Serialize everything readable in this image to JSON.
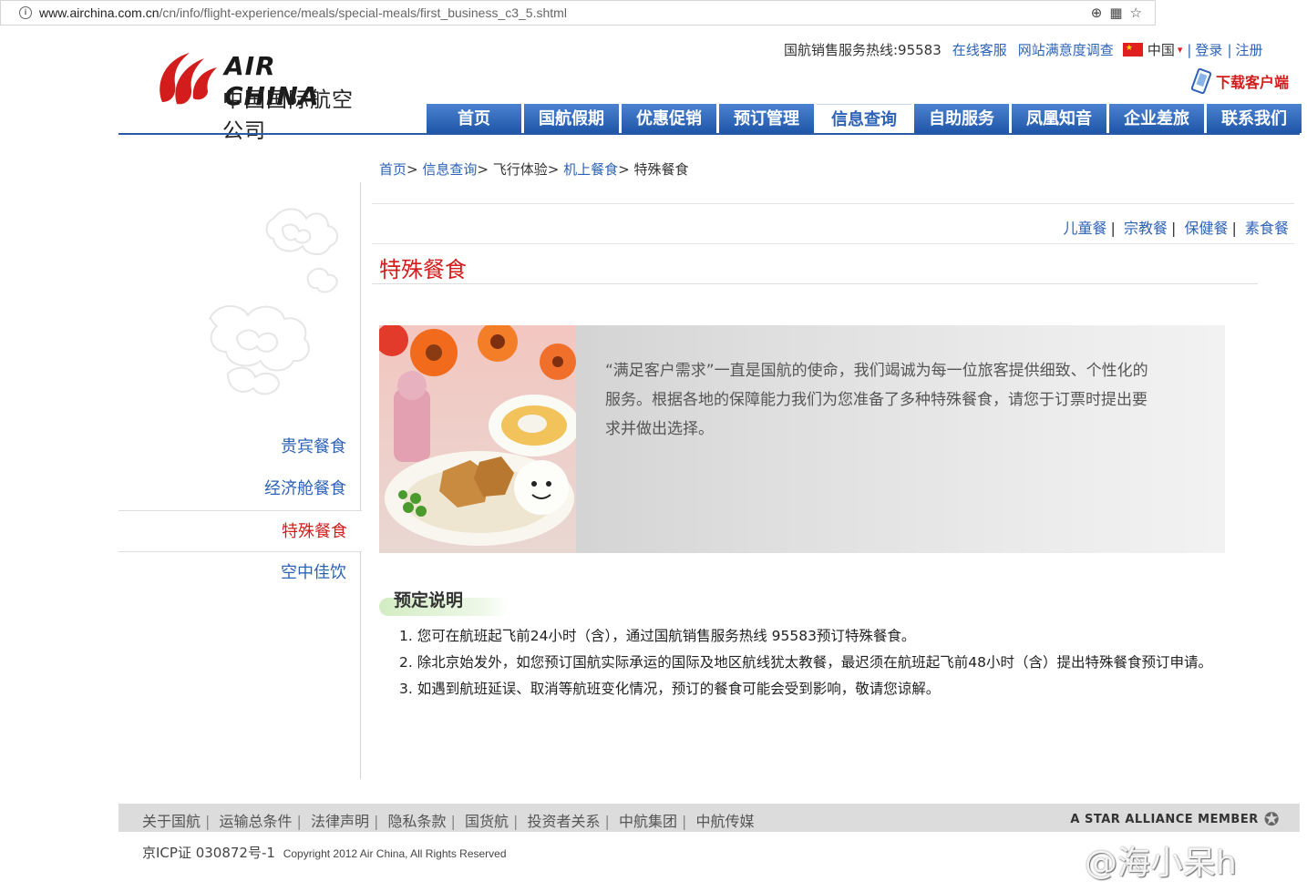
{
  "browser": {
    "url_host": "www.airchina.com.cn",
    "url_path": "/cn/info/flight-experience/meals/special-meals/first_business_c3_5.shtml",
    "tool_icons": [
      "zoom-icon",
      "qr-icon",
      "star-icon"
    ]
  },
  "header": {
    "logo_en": "AIR CHINA",
    "logo_cn": "中国国际航空公司",
    "hotline": "国航销售服务热线:95583",
    "online_service": "在线客服",
    "survey": "网站满意度调查",
    "country": "中国",
    "login": "登录",
    "register": "注册",
    "download_client": "下载客户端",
    "brand_red": "#d31c1c",
    "brand_blue": "#2d62b6"
  },
  "nav": [
    {
      "label": "首页"
    },
    {
      "label": "国航假期"
    },
    {
      "label": "优惠促销"
    },
    {
      "label": "预订管理"
    },
    {
      "label": "信息查询",
      "active": true
    },
    {
      "label": "自助服务"
    },
    {
      "label": "凤凰知音"
    },
    {
      "label": "企业差旅"
    },
    {
      "label": "联系我们"
    }
  ],
  "breadcrumb": {
    "home": "首页",
    "info": "信息查询",
    "experience": "飞行体验",
    "meals": "机上餐食",
    "current": "特殊餐食"
  },
  "sidebar": [
    {
      "label": "贵宾餐食"
    },
    {
      "label": "经济舱餐食"
    },
    {
      "label": "特殊餐食",
      "active": true
    },
    {
      "label": "空中佳饮"
    }
  ],
  "sublinks": [
    "儿童餐",
    "宗教餐",
    "保健餐",
    "素食餐"
  ],
  "main": {
    "title": "特殊餐食",
    "intro": "“满足客户需求”一直是国航的使命，我们竭诚为每一位旅客提供细致、个性化的服务。根据各地的保障能力我们为您准备了多种特殊餐食，请您于订票时提出要求并做出选择。",
    "section_title": "预定说明",
    "notes": [
      "1. 您可在航班起飞前24小时（含），通过国航销售服务热线 95583预订特殊餐食。",
      "2. 除北京始发外，如您预订国航实际承运的国际及地区航线犹太教餐，最迟须在航班起飞前48小时（含）提出特殊餐食预订申请。",
      "3. 如遇到航班延误、取消等航班变化情况，预订的餐食可能会受到影响，敬请您谅解。"
    ]
  },
  "footer": {
    "links": [
      "关于国航",
      "运输总条件",
      "法律声明",
      "隐私条款",
      "国货航",
      "投资者关系",
      "中航集团",
      "中航传媒"
    ],
    "star_alliance": "A STAR ALLIANCE MEMBER",
    "icp": "京ICP证 030872号-1",
    "copyright": "Copyright 2012 Air China, All Rights Reserved"
  },
  "watermark": "@海小呆h"
}
